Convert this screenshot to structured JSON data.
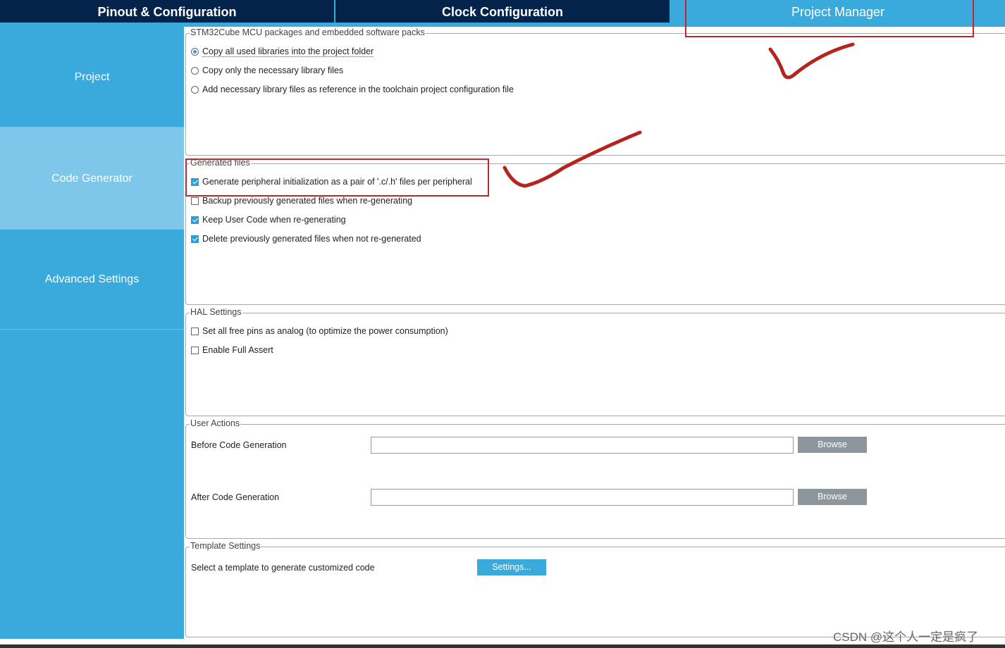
{
  "tabs": [
    {
      "label": "Pinout & Configuration"
    },
    {
      "label": "Clock Configuration"
    },
    {
      "label": "Project Manager"
    }
  ],
  "sidebar": {
    "items": [
      {
        "label": "Project"
      },
      {
        "label": "Code Generator"
      },
      {
        "label": "Advanced Settings"
      }
    ]
  },
  "packages": {
    "title": "STM32Cube MCU packages and embedded software packs",
    "options": [
      {
        "label": "Copy all used libraries into the project folder",
        "selected": true
      },
      {
        "label": "Copy only the necessary library files",
        "selected": false
      },
      {
        "label": "Add necessary library files as reference in the toolchain project configuration file",
        "selected": false
      }
    ]
  },
  "generated_files": {
    "title": "Generated files",
    "options": [
      {
        "label": "Generate peripheral initialization as a pair of '.c/.h' files per peripheral",
        "checked": true
      },
      {
        "label": "Backup previously generated files when re-generating",
        "checked": false
      },
      {
        "label": "Keep User Code when re-generating",
        "checked": true
      },
      {
        "label": "Delete previously generated files when not re-generated",
        "checked": true
      }
    ]
  },
  "hal_settings": {
    "title": "HAL Settings",
    "options": [
      {
        "label": "Set all free pins as analog (to optimize the power consumption)",
        "checked": false
      },
      {
        "label": "Enable Full Assert",
        "checked": false
      }
    ]
  },
  "user_actions": {
    "title": "User Actions",
    "before_label": "Before Code Generation",
    "before_value": "",
    "after_label": "After Code Generation",
    "after_value": "",
    "browse_label": "Browse"
  },
  "template_settings": {
    "title": "Template Settings",
    "label": "Select a template to generate customized code",
    "button": "Settings..."
  },
  "watermark": "CSDN @这个人一定是疯了",
  "colors": {
    "accent": "#3aa9dc",
    "dark_tab": "#03234b",
    "annotation_red": "#c0282c"
  }
}
